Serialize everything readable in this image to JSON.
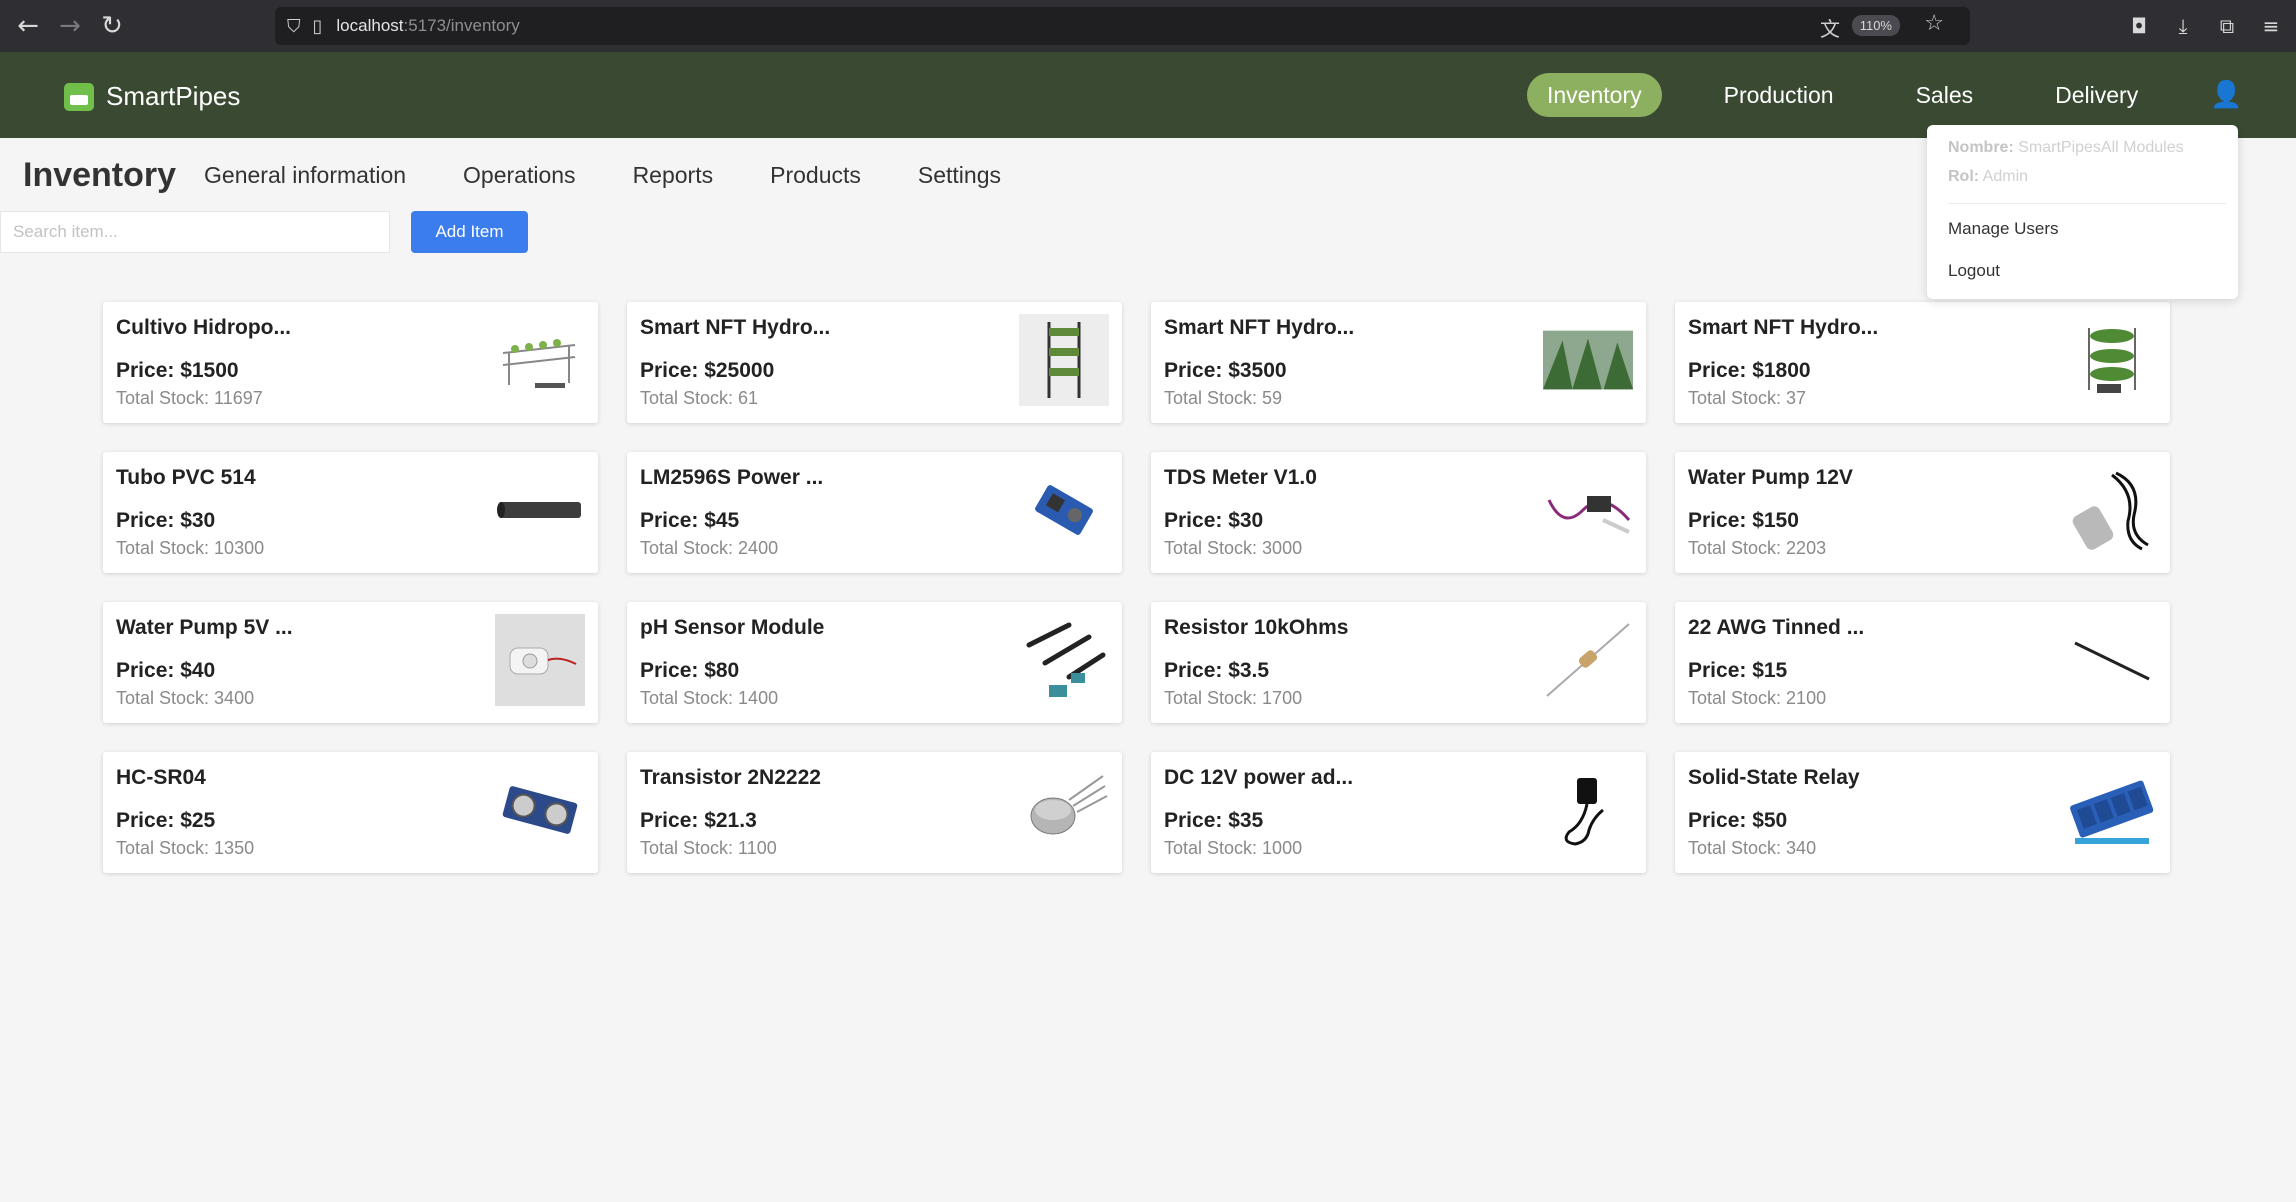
{
  "browser": {
    "url_host": "localhost",
    "url_path": ":5173/inventory",
    "zoom": "110%"
  },
  "app": {
    "brand": "SmartPipes",
    "nav": [
      {
        "label": "Inventory",
        "active": true
      },
      {
        "label": "Production",
        "active": false
      },
      {
        "label": "Sales",
        "active": false
      },
      {
        "label": "Delivery",
        "active": false
      }
    ]
  },
  "subnav": {
    "title": "Inventory",
    "tabs": [
      "General information",
      "Operations",
      "Reports",
      "Products",
      "Settings"
    ]
  },
  "search": {
    "placeholder": "Search item...",
    "value": ""
  },
  "add_button": "Add Item",
  "user_menu": {
    "name_label": "Nombre:",
    "name_value": "SmartPipesAll Modules",
    "role_label": "Rol:",
    "role_value": "Admin",
    "items": [
      "Manage Users",
      "Logout"
    ]
  },
  "products": [
    {
      "name": "Cultivo Hidropo...",
      "price": "Price: $1500",
      "stock": "Total Stock: 11697",
      "icon": "hydroponic-rack-image"
    },
    {
      "name": "Smart NFT Hydro...",
      "price": "Price: $25000",
      "stock": "Total Stock: 61",
      "icon": "vertical-tower-image"
    },
    {
      "name": "Smart NFT Hydro...",
      "price": "Price: $3500",
      "stock": "Total Stock: 59",
      "icon": "greenhouse-image"
    },
    {
      "name": "Smart NFT Hydro...",
      "price": "Price: $1800",
      "stock": "Total Stock: 37",
      "icon": "plant-tower-image"
    },
    {
      "name": "Tubo PVC 514",
      "price": "Price: $30",
      "stock": "Total Stock: 10300",
      "icon": "pvc-pipe-image"
    },
    {
      "name": "LM2596S Power ...",
      "price": "Price: $45",
      "stock": "Total Stock: 2400",
      "icon": "power-module-image"
    },
    {
      "name": "TDS Meter V1.0",
      "price": "Price: $30",
      "stock": "Total Stock: 3000",
      "icon": "tds-meter-image"
    },
    {
      "name": "Water Pump 12V",
      "price": "Price: $150",
      "stock": "Total Stock: 2203",
      "icon": "water-pump-image"
    },
    {
      "name": "Water Pump 5V ...",
      "price": "Price: $40",
      "stock": "Total Stock: 3400",
      "icon": "mini-pump-image"
    },
    {
      "name": "pH Sensor Module",
      "price": "Price: $80",
      "stock": "Total Stock: 1400",
      "icon": "ph-sensor-image"
    },
    {
      "name": "Resistor 10kOhms",
      "price": "Price: $3.5",
      "stock": "Total Stock: 1700",
      "icon": "resistor-image"
    },
    {
      "name": "22 AWG Tinned ...",
      "price": "Price: $15",
      "stock": "Total Stock: 2100",
      "icon": "wire-image"
    },
    {
      "name": "HC-SR04",
      "price": "Price: $25",
      "stock": "Total Stock: 1350",
      "icon": "ultrasonic-sensor-image"
    },
    {
      "name": "Transistor 2N2222",
      "price": "Price: $21.3",
      "stock": "Total Stock: 1100",
      "icon": "transistor-image"
    },
    {
      "name": "DC 12V power ad...",
      "price": "Price: $35",
      "stock": "Total Stock: 1000",
      "icon": "power-adapter-image"
    },
    {
      "name": "Solid-State Relay",
      "price": "Price: $50",
      "stock": "Total Stock: 340",
      "icon": "relay-board-image"
    }
  ]
}
